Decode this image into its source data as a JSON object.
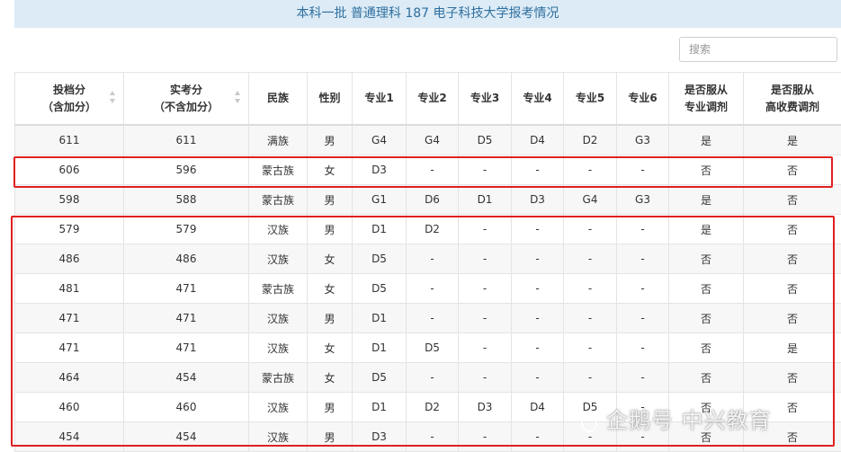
{
  "page_title": "本科一批 普通理科 187 电子科技大学报考情况",
  "search": {
    "placeholder": "搜索"
  },
  "table": {
    "columns": [
      {
        "line1": "投档分",
        "line2": "（含加分）",
        "sortable": true
      },
      {
        "line1": "实考分",
        "line2": "（不含加分）",
        "sortable": true
      },
      {
        "line1": "民族",
        "line2": ""
      },
      {
        "line1": "性别",
        "line2": ""
      },
      {
        "line1": "专业1",
        "line2": ""
      },
      {
        "line1": "专业2",
        "line2": ""
      },
      {
        "line1": "专业3",
        "line2": ""
      },
      {
        "line1": "专业4",
        "line2": ""
      },
      {
        "line1": "专业5",
        "line2": ""
      },
      {
        "line1": "专业6",
        "line2": ""
      },
      {
        "line1": "是否服从",
        "line2": "专业调剂"
      },
      {
        "line1": "是否服从",
        "line2": "高收费调剂"
      }
    ],
    "rows": [
      [
        "611",
        "611",
        "满族",
        "男",
        "G4",
        "G4",
        "D5",
        "D4",
        "D2",
        "G3",
        "是",
        "是"
      ],
      [
        "606",
        "596",
        "蒙古族",
        "女",
        "D3",
        "-",
        "-",
        "-",
        "-",
        "-",
        "否",
        "否"
      ],
      [
        "598",
        "588",
        "蒙古族",
        "男",
        "G1",
        "D6",
        "D1",
        "D3",
        "G4",
        "G3",
        "是",
        "否"
      ],
      [
        "579",
        "579",
        "汉族",
        "男",
        "D1",
        "D2",
        "-",
        "-",
        "-",
        "-",
        "是",
        "否"
      ],
      [
        "486",
        "486",
        "汉族",
        "女",
        "D5",
        "-",
        "-",
        "-",
        "-",
        "-",
        "否",
        "否"
      ],
      [
        "481",
        "471",
        "蒙古族",
        "女",
        "D5",
        "-",
        "-",
        "-",
        "-",
        "-",
        "否",
        "否"
      ],
      [
        "471",
        "471",
        "汉族",
        "男",
        "D1",
        "-",
        "-",
        "-",
        "-",
        "-",
        "否",
        "否"
      ],
      [
        "471",
        "471",
        "汉族",
        "女",
        "D1",
        "D5",
        "-",
        "-",
        "-",
        "-",
        "否",
        "是"
      ],
      [
        "464",
        "454",
        "蒙古族",
        "女",
        "D5",
        "-",
        "-",
        "-",
        "-",
        "-",
        "否",
        "否"
      ],
      [
        "460",
        "460",
        "汉族",
        "男",
        "D1",
        "D2",
        "D3",
        "D4",
        "D5",
        "-",
        "否",
        "否"
      ],
      [
        "454",
        "454",
        "汉族",
        "男",
        "D3",
        "-",
        "-",
        "-",
        "-",
        "-",
        "否",
        "否"
      ]
    ]
  },
  "highlight_color": "#e02020",
  "watermark": {
    "text": "企鹅号 中兴教育",
    "icon": "penguin-logo-icon"
  }
}
